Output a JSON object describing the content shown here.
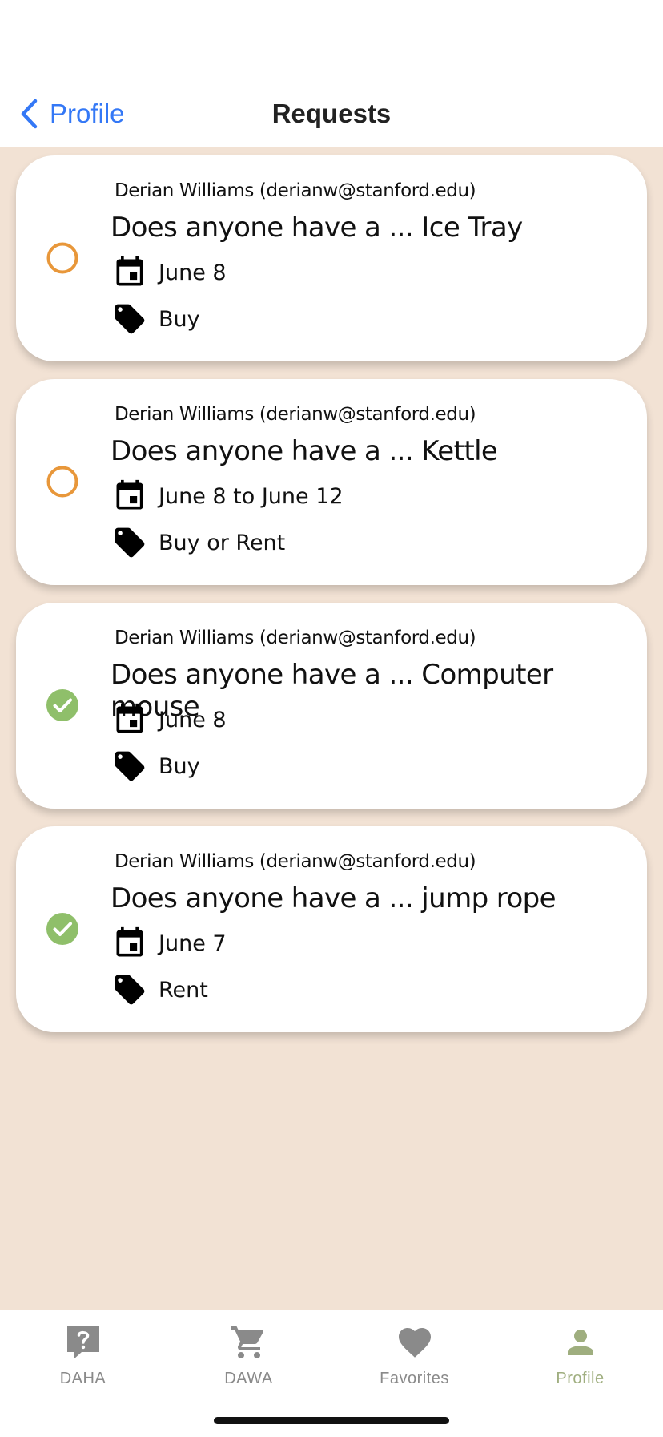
{
  "header": {
    "back_label": "Profile",
    "title": "Requests"
  },
  "requests": [
    {
      "author": "Derian Williams (derianw@stanford.edu)",
      "title": "Does anyone have a ... Ice Tray",
      "date": "June 8",
      "type": "Buy",
      "status": "open"
    },
    {
      "author": "Derian Williams (derianw@stanford.edu)",
      "title": "Does anyone have a ... Kettle",
      "date": "June 8 to June 12",
      "type": "Buy or Rent",
      "status": "open"
    },
    {
      "author": "Derian Williams (derianw@stanford.edu)",
      "title": "Does anyone have a ... Computer mouse",
      "date": "June 8",
      "type": "Buy",
      "status": "fulfilled"
    },
    {
      "author": "Derian Williams (derianw@stanford.edu)",
      "title": "Does anyone have a ... jump rope",
      "date": "June 7",
      "type": "Rent",
      "status": "fulfilled"
    }
  ],
  "tabs": [
    {
      "label": "DAHA",
      "icon": "question-bubble-icon"
    },
    {
      "label": "DAWA",
      "icon": "cart-icon"
    },
    {
      "label": "Favorites",
      "icon": "heart-icon"
    },
    {
      "label": "Profile",
      "icon": "person-icon",
      "active": true
    }
  ],
  "colors": {
    "background": "#f2e2d4",
    "accent_blue": "#3478f6",
    "open_status": "#e8973a",
    "fulfilled_status": "#8fbf6a",
    "active_tab": "#9fae7f",
    "inactive_tab": "#8a8a8a"
  }
}
